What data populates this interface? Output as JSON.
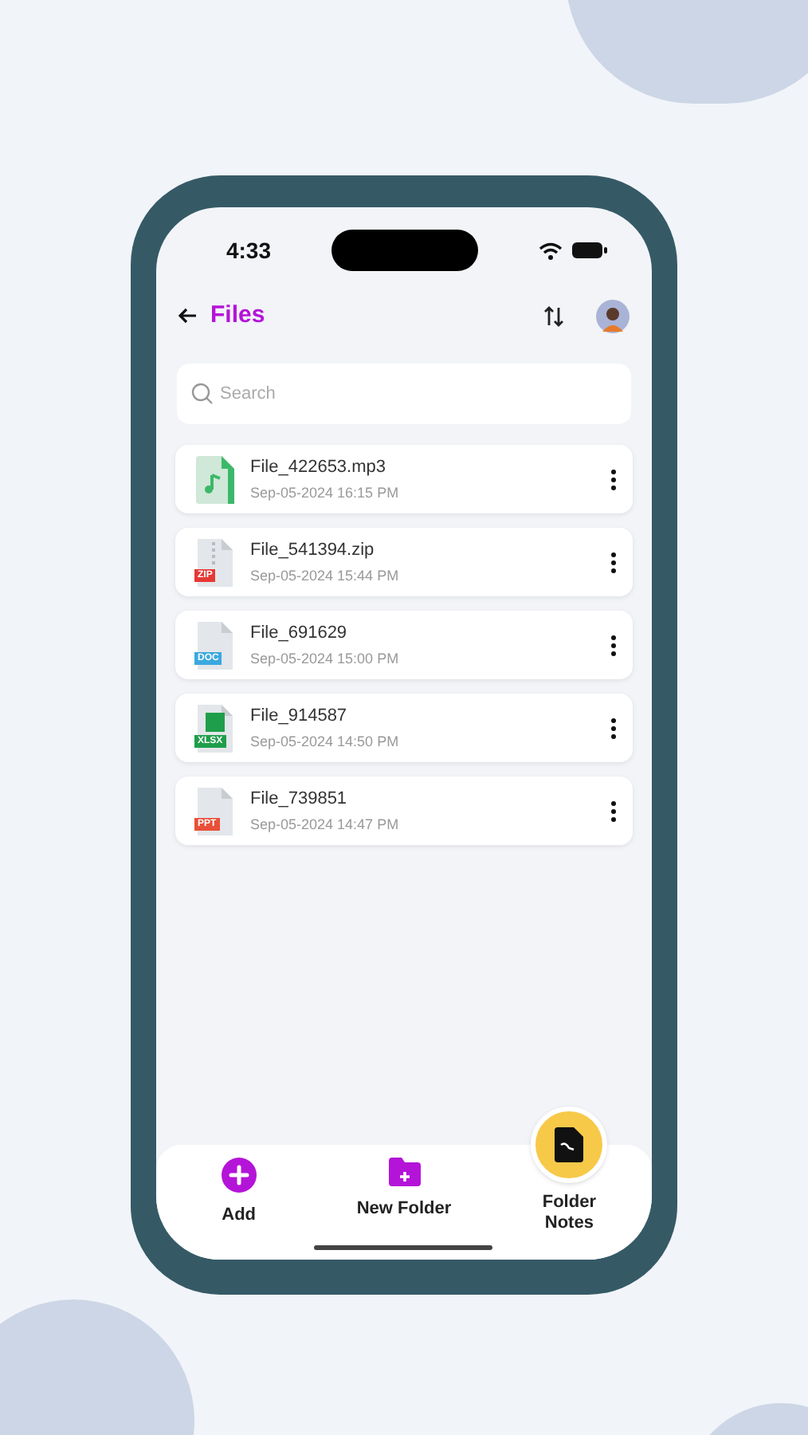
{
  "status_bar": {
    "time": "4:33"
  },
  "header": {
    "title": "Files"
  },
  "search": {
    "placeholder": "Search"
  },
  "files": [
    {
      "kind": "audio",
      "name": "File_422653.mp3",
      "date": "Sep-05-2024 16:15 PM"
    },
    {
      "kind": "zip",
      "badge": "ZIP",
      "name": "File_541394.zip",
      "date": "Sep-05-2024 15:44 PM"
    },
    {
      "kind": "doc",
      "badge": "DOC",
      "name": "File_691629",
      "date": "Sep-05-2024 15:00 PM"
    },
    {
      "kind": "xlsx",
      "badge": "XLSX",
      "name": "File_914587",
      "date": "Sep-05-2024 14:50 PM"
    },
    {
      "kind": "ppt",
      "badge": "PPT",
      "name": "File_739851",
      "date": "Sep-05-2024 14:47 PM"
    }
  ],
  "bottom_bar": [
    {
      "kind": "add",
      "label": "Add"
    },
    {
      "kind": "folder",
      "label": "New Folder"
    },
    {
      "kind": "notes",
      "label": "Folder Notes"
    }
  ]
}
